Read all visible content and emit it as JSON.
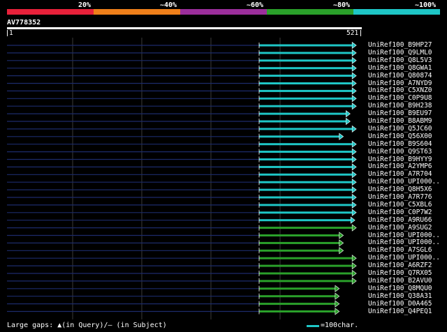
{
  "legend": {
    "labels": [
      "20%",
      "~40%",
      "~60%",
      "~80%",
      "~100%"
    ],
    "colors": [
      "#e8213a",
      "#ef7f1a",
      "#9b2e9b",
      "#2aa02a",
      "#1ec6c6"
    ]
  },
  "query": {
    "id": "AV778352",
    "start": "1",
    "end": "521"
  },
  "hits": [
    {
      "name": "UniRef100_B9HP27",
      "color": "cyan",
      "end": 515
    },
    {
      "name": "UniRef100_Q9LML0",
      "color": "cyan",
      "end": 515
    },
    {
      "name": "UniRef100_Q8L5V3",
      "color": "cyan",
      "end": 515
    },
    {
      "name": "UniRef100_Q8GWA1",
      "color": "cyan",
      "end": 515
    },
    {
      "name": "UniRef100_Q80874",
      "color": "cyan",
      "end": 515
    },
    {
      "name": "UniRef100_A7NYD9",
      "color": "cyan",
      "end": 515
    },
    {
      "name": "UniRef100_C5XNZ0",
      "color": "cyan",
      "end": 515
    },
    {
      "name": "UniRef100_C0P9U8",
      "color": "cyan",
      "end": 515
    },
    {
      "name": "UniRef100_B9H238",
      "color": "cyan",
      "end": 515
    },
    {
      "name": "UniRef100_B9EU97",
      "color": "cyan",
      "end": 506
    },
    {
      "name": "UniRef100_B8ABM9",
      "color": "cyan",
      "end": 506
    },
    {
      "name": "UniRef100_Q5JC60",
      "color": "cyan",
      "end": 515
    },
    {
      "name": "UniRef100_Q56X00",
      "color": "cyan",
      "end": 496
    },
    {
      "name": "UniRef100_B9S604",
      "color": "cyan",
      "end": 515
    },
    {
      "name": "UniRef100_Q9ST63",
      "color": "cyan",
      "end": 515
    },
    {
      "name": "UniRef100_B9HYY9",
      "color": "cyan",
      "end": 515
    },
    {
      "name": "UniRef100_A2YMP6",
      "color": "cyan",
      "end": 515
    },
    {
      "name": "UniRef100_A7R704",
      "color": "cyan",
      "end": 515
    },
    {
      "name": "UniRef100_UPI000..",
      "color": "cyan",
      "end": 515
    },
    {
      "name": "UniRef100_Q8H5X6",
      "color": "cyan",
      "end": 515
    },
    {
      "name": "UniRef100_A7R776",
      "color": "cyan",
      "end": 515
    },
    {
      "name": "UniRef100_C5XBL6",
      "color": "cyan",
      "end": 515
    },
    {
      "name": "UniRef100_C0P7W2",
      "color": "cyan",
      "end": 515
    },
    {
      "name": "UniRef100_A9RU66",
      "color": "cyan",
      "end": 513
    },
    {
      "name": "UniRef100_A9SUG2",
      "color": "green",
      "end": 515
    },
    {
      "name": "UniRef100_UPI000..",
      "color": "green",
      "end": 496
    },
    {
      "name": "UniRef100_UPI000..",
      "color": "green",
      "end": 496
    },
    {
      "name": "UniRef100_A7SGL6",
      "color": "green",
      "end": 496
    },
    {
      "name": "UniRef100_UPI000..",
      "color": "green",
      "end": 515
    },
    {
      "name": "UniRef100_A6RZF2",
      "color": "green",
      "end": 515
    },
    {
      "name": "UniRef100_Q7RX05",
      "color": "green",
      "end": 515
    },
    {
      "name": "UniRef100_B2AVU0",
      "color": "green",
      "end": 515
    },
    {
      "name": "UniRef100_Q8MQU0",
      "color": "green",
      "end": 490
    },
    {
      "name": "UniRef100_Q38A31",
      "color": "green",
      "end": 490
    },
    {
      "name": "UniRef100_D0A465",
      "color": "green",
      "end": 490
    },
    {
      "name": "UniRef100_Q4PEQ1",
      "color": "green",
      "end": 490
    }
  ],
  "hit_colors": {
    "cyan": "#1ec6c6",
    "green": "#2aa02a",
    "unaligned": "#1c2b6b"
  },
  "footer": {
    "gaps_text": "Large gaps: ▲(in Query)/– (in Subject)",
    "scale_text": "=100char."
  }
}
